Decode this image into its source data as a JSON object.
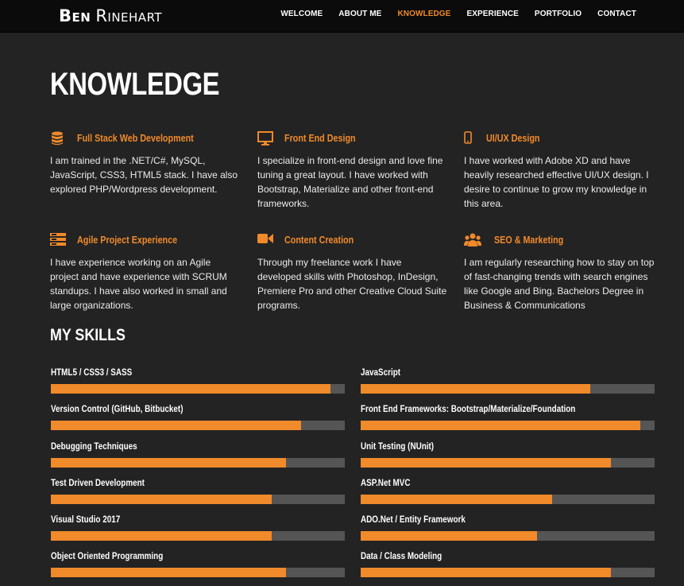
{
  "brand": {
    "first": "Ben",
    "last": "Rinehart"
  },
  "nav": [
    {
      "label": "Welcome",
      "active": false
    },
    {
      "label": "About Me",
      "active": false
    },
    {
      "label": "Knowledge",
      "active": true
    },
    {
      "label": "Experience",
      "active": false
    },
    {
      "label": "Portfolio",
      "active": false
    },
    {
      "label": "Contact",
      "active": false
    }
  ],
  "page_title": "KNOWLEDGE",
  "features": [
    {
      "icon": "database-icon",
      "title": "Full Stack Web Development",
      "text": "I am trained in the .NET/C#, MySQL, JavaScript, CSS3, HTML5 stack. I have also explored PHP/Wordpress development."
    },
    {
      "icon": "monitor-icon",
      "title": "Front End Design",
      "text": "I specialize in front-end design and love fine tuning a great layout. I have worked with Bootstrap, Materialize and other front-end frameworks."
    },
    {
      "icon": "mobile-icon",
      "title": "UI/UX Design",
      "text": "I have worked with Adobe XD and have heavily researched effective UI/UX design. I desire to continue to grow my knowledge in this area."
    },
    {
      "icon": "server-icon",
      "title": "Agile Project Experience",
      "text": "I have experience working on an Agile project and have experience with SCRUM standups. I have also worked in small and large organizations."
    },
    {
      "icon": "video-camera-icon",
      "title": "Content Creation",
      "text": "Through my freelance work I have developed skills with Photoshop, InDesign, Premiere Pro and other Creative Cloud Suite programs."
    },
    {
      "icon": "users-icon",
      "title": "SEO & Marketing",
      "text": "I am regularly researching how to stay on top of fast-changing trends with search engines like Google and Bing. Bachelors Degree in Business & Communications"
    }
  ],
  "skills_title": "MY SKILLS",
  "skills": [
    {
      "label": "HTML5 / CSS3 / SASS",
      "percent": 95
    },
    {
      "label": "JavaScript",
      "percent": 78
    },
    {
      "label": "Version Control (GitHub, Bitbucket)",
      "percent": 85
    },
    {
      "label": "Front End Frameworks: Bootstrap/Materialize/Foundation",
      "percent": 95
    },
    {
      "label": "Debugging Techniques",
      "percent": 80
    },
    {
      "label": "Unit Testing (NUnit)",
      "percent": 85
    },
    {
      "label": "Test Driven Development",
      "percent": 75
    },
    {
      "label": "ASP.Net MVC",
      "percent": 65
    },
    {
      "label": "Visual Studio 2017",
      "percent": 75
    },
    {
      "label": "ADO.Net / Entity Framework",
      "percent": 60
    },
    {
      "label": "Object Oriented Programming",
      "percent": 80
    },
    {
      "label": "Data / Class Modeling",
      "percent": 85
    }
  ],
  "colors": {
    "accent": "#f08a2a",
    "track": "#555555",
    "background": "#232323",
    "navbar": "#0b0b0b"
  }
}
